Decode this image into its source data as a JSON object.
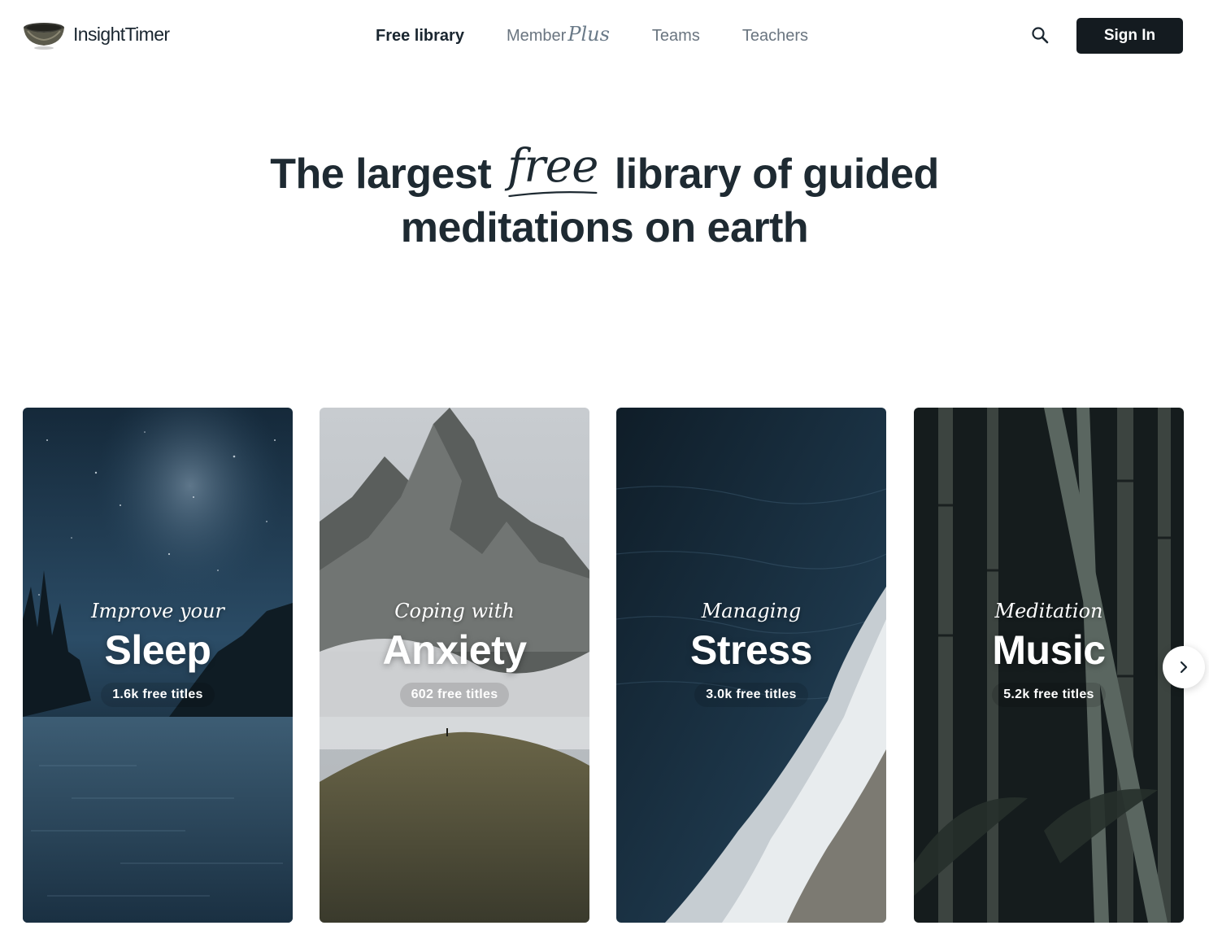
{
  "brand": {
    "name": "InsightTimer",
    "logo_icon": "singing-bowl-icon"
  },
  "nav": {
    "items": [
      {
        "label": "Free library",
        "active": true
      },
      {
        "label": "Member",
        "suffix": "Plus"
      },
      {
        "label": "Teams"
      },
      {
        "label": "Teachers"
      }
    ]
  },
  "header": {
    "search_icon": "search-icon",
    "signin_label": "Sign In"
  },
  "hero": {
    "line1_before": "The largest",
    "line1_script": "free",
    "line1_after": "library of guided",
    "line2": "meditations on earth"
  },
  "cards": [
    {
      "subtitle": "Improve your",
      "title": "Sleep",
      "count": "1.6k free titles",
      "theme": "night-lake"
    },
    {
      "subtitle": "Coping with",
      "title": "Anxiety",
      "count": "602 free titles",
      "theme": "mountain"
    },
    {
      "subtitle": "Managing",
      "title": "Stress",
      "count": "3.0k free titles",
      "theme": "ocean"
    },
    {
      "subtitle": "Meditation",
      "title": "Music",
      "count": "5.2k free titles",
      "theme": "bamboo"
    }
  ],
  "carousel": {
    "next_icon": "chevron-right-icon"
  },
  "colors": {
    "text_dark": "#1e2a32",
    "nav_muted": "#6a7580",
    "button_dark": "#141b20"
  }
}
